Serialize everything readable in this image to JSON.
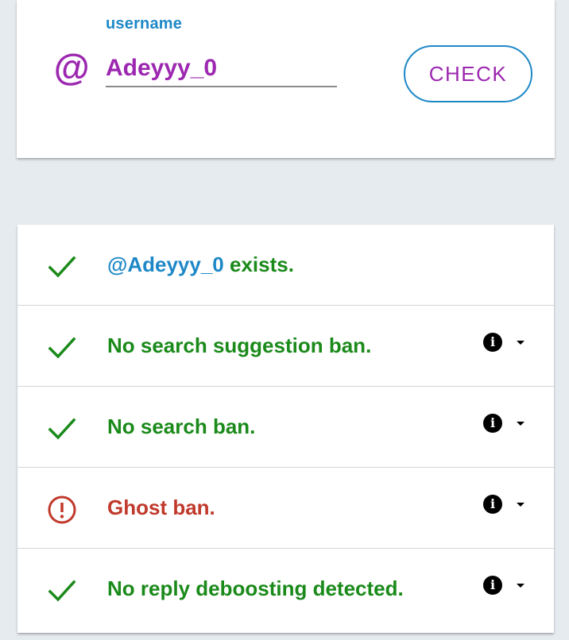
{
  "colors": {
    "label_blue": "#1e88c7",
    "purple": "#9c27b0",
    "green": "#1a8a1a",
    "red": "#c0392b"
  },
  "search": {
    "label": "username",
    "at_symbol": "@",
    "value": "Adeyyy_0",
    "check_label": "CHECK"
  },
  "results": [
    {
      "status": "ok",
      "handle": "@Adeyyy_0",
      "text": " exists.",
      "has_info": false
    },
    {
      "status": "ok",
      "text": "No search suggestion ban.",
      "has_info": true
    },
    {
      "status": "ok",
      "text": "No search ban.",
      "has_info": true
    },
    {
      "status": "warning",
      "text": "Ghost ban.",
      "has_info": true
    },
    {
      "status": "ok",
      "text": "No reply deboosting detected.",
      "has_info": true
    }
  ],
  "icons": {
    "ok": "check-icon",
    "warning": "alert-circle-icon",
    "info": "info-icon",
    "dropdown": "dropdown-arrow-icon"
  }
}
